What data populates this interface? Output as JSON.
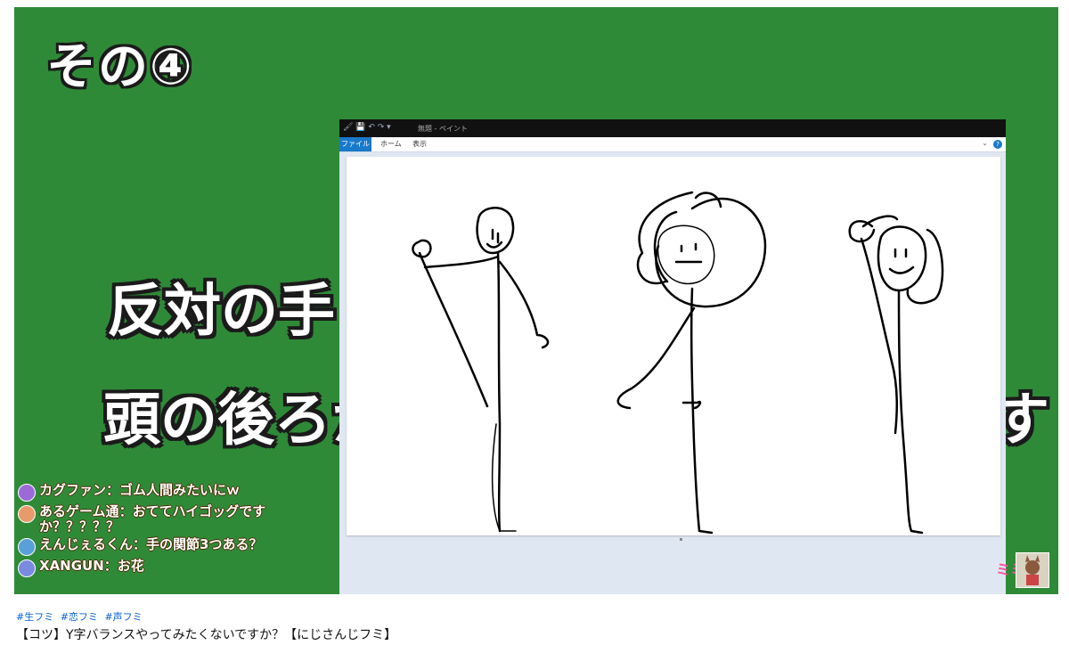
{
  "video": {
    "section_title": "その④",
    "line1": "反対の手",
    "line2": "頭の後ろか",
    "line2_tail": "す"
  },
  "paint_window": {
    "title": "無題 - ペイント",
    "tabs": [
      "ファイル",
      "ホーム",
      "表示"
    ]
  },
  "chat": [
    {
      "author": "カグファン",
      "message": "ゴム人間みたいにｗ",
      "avatar_color": "#9b6ad8"
    },
    {
      "author": "あるゲーム通",
      "message": "おててハイゴッグですか？？？？？",
      "avatar_color": "#e89a6a"
    },
    {
      "author": "えんじぇるくん",
      "message": "手の関節3つある？",
      "avatar_color": "#5aa0d8"
    },
    {
      "author": "XANGUN",
      "message": "お花",
      "avatar_color": "#7a8ae0"
    }
  ],
  "stream_deco": "ミミ",
  "hashtags": [
    "#生フミ",
    "#恋フミ",
    "#声フミ"
  ],
  "video_title": "【コツ】Y字バランスやってみたくないですか？【にじさんじフミ】",
  "colors": {
    "video_bg": "#2f8a37",
    "hashtag": "#065fd4",
    "paint_tab": "#1979ca"
  }
}
